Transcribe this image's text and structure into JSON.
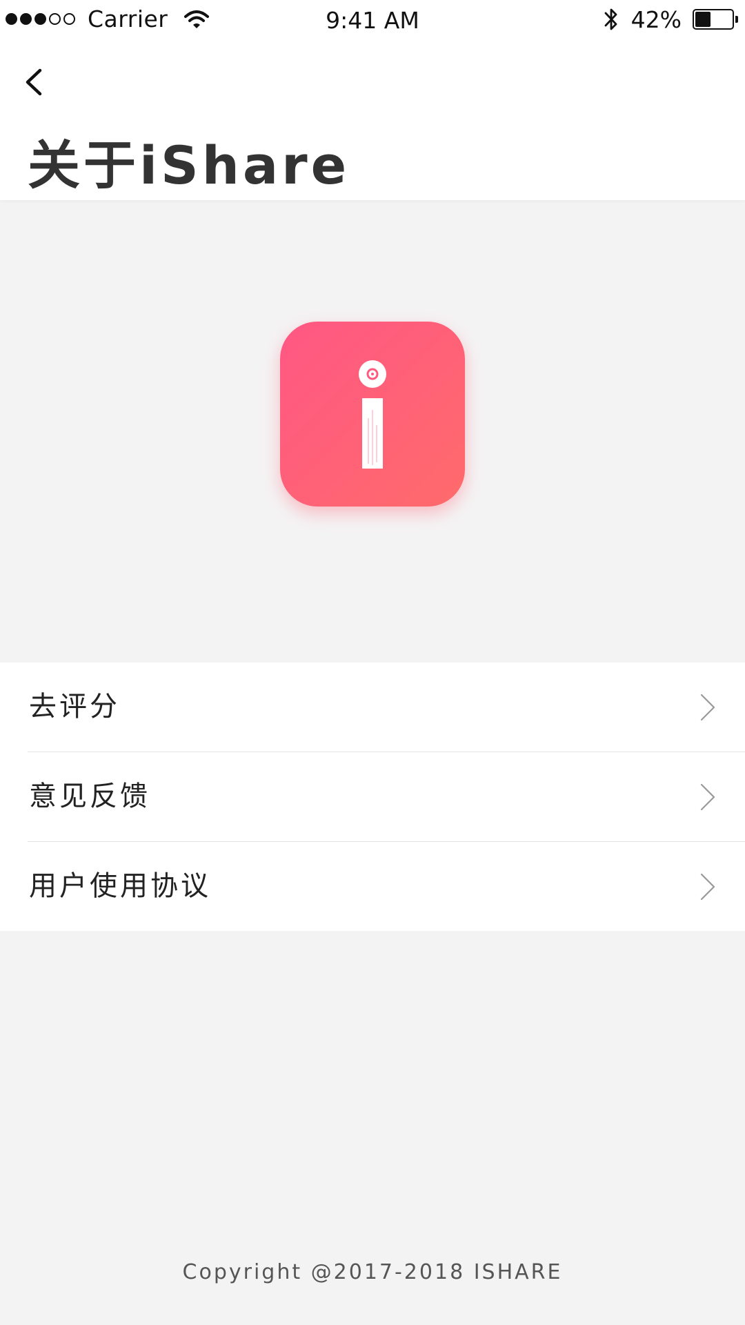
{
  "status_bar": {
    "signal_bars_filled": 3,
    "signal_bars_total": 5,
    "carrier": "Carrier",
    "time": "9:41 AM",
    "battery_percent_text": "42%",
    "battery_level": 0.42
  },
  "header": {
    "back_icon": "chevron-left-icon",
    "title": "关于iShare"
  },
  "app_logo": {
    "icon": "ishare-logo",
    "gradient_start": "#ff5784",
    "gradient_end": "#ff6b6b"
  },
  "menu": {
    "items": [
      {
        "label": "去评分",
        "icon": "chevron-right-icon"
      },
      {
        "label": "意见反馈",
        "icon": "chevron-right-icon"
      },
      {
        "label": "用户使用协议",
        "icon": "chevron-right-icon"
      }
    ]
  },
  "footer": {
    "copyright": "Copyright @2017-2018 ISHARE"
  }
}
